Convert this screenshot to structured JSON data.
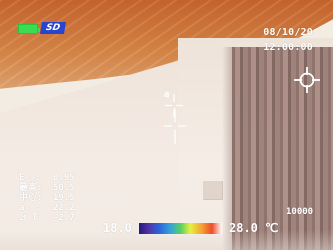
{
  "status": {
    "battery_icon": "battery-icon",
    "storage_label": "SD",
    "date": "08/10/20",
    "time": "12:00:00"
  },
  "markers": {
    "a_label": "a"
  },
  "readouts": [
    {
      "label": "E =:",
      "value": "0.95"
    },
    {
      "label": "最高:",
      "value": "50.5"
    },
    {
      "label": "中心:",
      "value": "19.5"
    },
    {
      "label": "a  :",
      "value": "22.2"
    },
    {
      "label": "⊿ T:",
      "value": "-2.7"
    }
  ],
  "scale": {
    "min": "18.0",
    "max": "28.0",
    "unit": "℃"
  },
  "zoom": "10000",
  "icons": {
    "right_target": "target-icon",
    "center_crosshair": "crosshair-icon",
    "marker_a_crosshair": "crosshair-icon"
  },
  "colors": {
    "battery": "#3adb55",
    "storage": "#2745cf",
    "overlay_text": "#ffffff",
    "target": "#ffffff"
  }
}
